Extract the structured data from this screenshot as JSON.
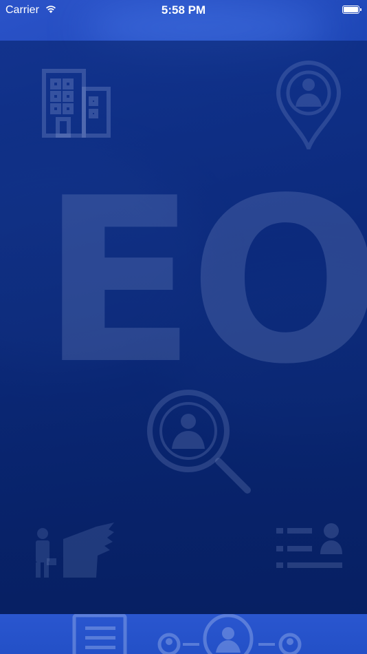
{
  "status_bar": {
    "carrier": "Carrier",
    "time": "5:58 PM"
  },
  "splash": {
    "logo_text": "EO"
  },
  "icons": {
    "top_left": "office-building-icon",
    "top_right": "user-location-pin-icon",
    "center": "search-user-icon",
    "bottom_left": "job-seeker-handshake-icon",
    "bottom_right": "user-list-icon",
    "wifi": "wifi-icon",
    "battery": "battery-icon"
  },
  "colors": {
    "background": "#1f48b8",
    "overlay": "#0b2a7a",
    "watermark": "#96aadc"
  }
}
